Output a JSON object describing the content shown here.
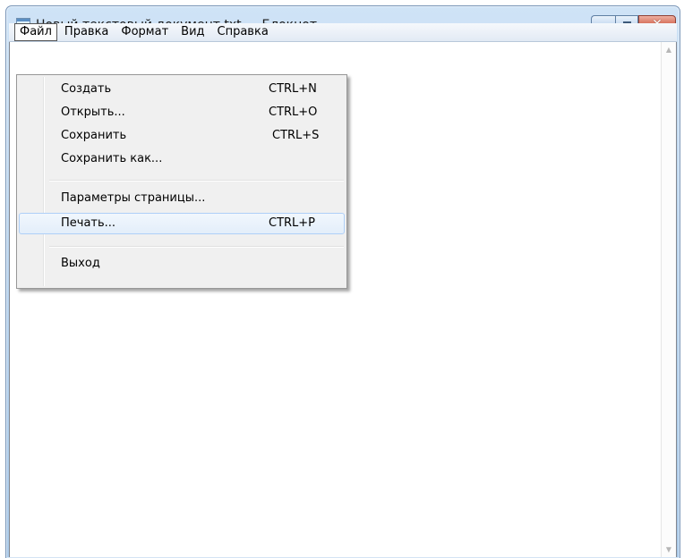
{
  "window": {
    "title": "Новый текстовый документ.txt — Блокнот",
    "close_glyph": "✕"
  },
  "menubar": {
    "items": [
      "Файл",
      "Правка",
      "Формат",
      "Вид",
      "Справка"
    ],
    "active": "Файл"
  },
  "file_menu": {
    "items": [
      {
        "label": "Создать",
        "shortcut": "CTRL+N"
      },
      {
        "label": "Открыть...",
        "shortcut": "CTRL+O"
      },
      {
        "label": "Сохранить",
        "shortcut": "CTRL+S"
      },
      {
        "label": "Сохранить как...",
        "shortcut": ""
      },
      {
        "label": "Параметры страницы...",
        "shortcut": ""
      },
      {
        "label": "Печать...",
        "shortcut": "CTRL+P"
      },
      {
        "label": "Выход",
        "shortcut": ""
      }
    ],
    "highlighted": "Печать..."
  },
  "scrollbar": {
    "up_arrow": "▲",
    "down_arrow": "▼"
  }
}
